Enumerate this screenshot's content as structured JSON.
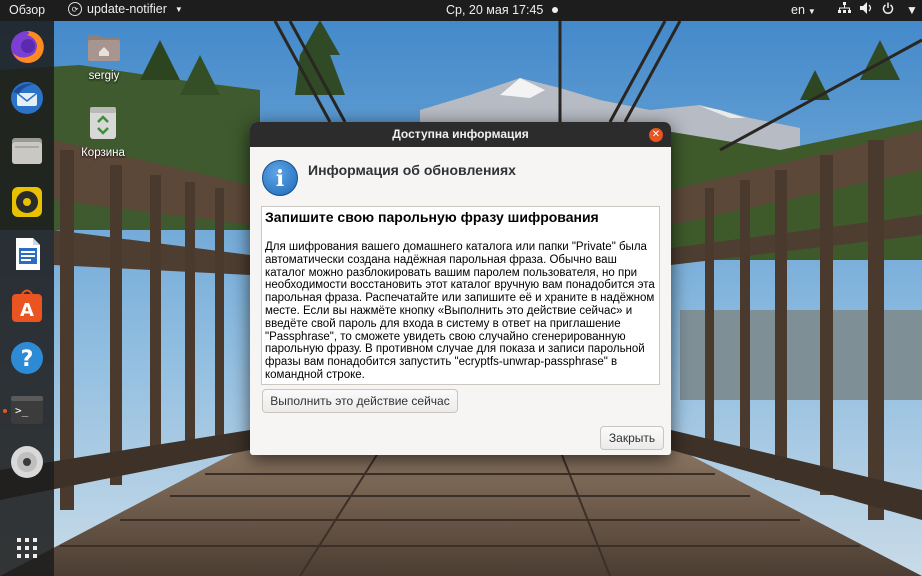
{
  "topbar": {
    "activities": "Обзор",
    "app_menu": "update-notifier",
    "clock": "Ср, 20 мая  17:45",
    "language": "en",
    "icons": [
      "network-icon",
      "volume-icon",
      "power-icon"
    ]
  },
  "dock": {
    "items": [
      {
        "name": "firefox",
        "icon": "firefox-icon"
      },
      {
        "name": "thunderbird",
        "icon": "thunderbird-icon"
      },
      {
        "name": "files",
        "icon": "files-icon"
      },
      {
        "name": "rhythmbox",
        "icon": "rhythmbox-icon"
      },
      {
        "name": "libreoffice-writer",
        "icon": "writer-icon"
      },
      {
        "name": "software",
        "icon": "software-center-icon"
      },
      {
        "name": "help",
        "icon": "help-icon"
      },
      {
        "name": "terminal",
        "icon": "terminal-icon"
      },
      {
        "name": "disc",
        "icon": "cd-icon"
      },
      {
        "name": "show-apps",
        "icon": "app-grid-icon"
      }
    ],
    "colors": {
      "accent": "#e95420"
    }
  },
  "desktop": {
    "icons": [
      {
        "label": "sergiy",
        "icon": "home-folder-icon"
      },
      {
        "label": "Корзина",
        "icon": "trash-icon"
      }
    ]
  },
  "dialog": {
    "title": "Доступна информация",
    "heading": "Информация об обновлениях",
    "content_title": "Запишите свою парольную фразу шифрования",
    "content_body": "Для шифрования вашего домашнего каталога или папки \"Private\" была автоматически создана надёжная парольная фраза. Обычно ваш каталог можно разблокировать вашим паролем пользователя, но при необходимости восстановить этот каталог вручную вам понадобится эта парольная фраза. Распечатайте или запишите её и храните в надёжном месте. Если вы нажмёте кнопку «Выполнить это действие сейчас» и введёте свой пароль для входа в систему в ответ на приглашение \"Passphrase\", то сможете увидеть свою случайно сгенерированную парольную фразу. В противном случае для показа и записи парольной фразы вам понадобится запустить \"ecryptfs-unwrap-passphrase\" в командной строке.",
    "action_button": "Выполнить это действие сейчас",
    "close_button": "Закрыть",
    "close_icon": "close-icon",
    "info_icon": "info-icon"
  }
}
